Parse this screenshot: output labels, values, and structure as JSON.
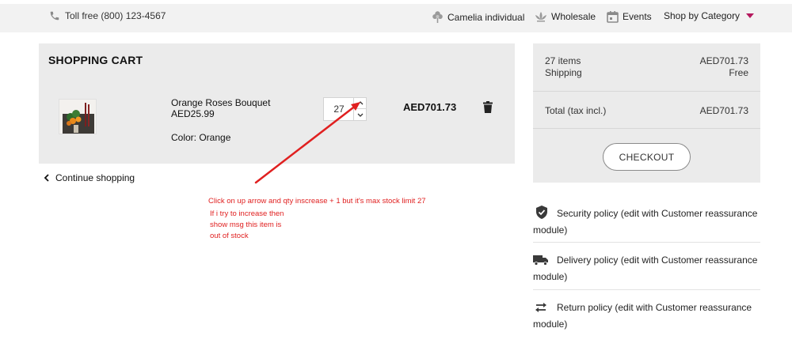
{
  "header": {
    "phone": "Toll free (800) 123-4567",
    "nav": [
      {
        "label": "Camelia individual",
        "icon": "flower-icon"
      },
      {
        "label": "Wholesale",
        "icon": "lotus-icon"
      },
      {
        "label": "Events",
        "icon": "calendar-icon"
      },
      {
        "label": "Shop by Category",
        "icon": "caret-down-icon"
      }
    ]
  },
  "cart": {
    "title": "SHOPPING CART",
    "item": {
      "name": "Orange Roses Bouquet",
      "unit_price": "AED25.99",
      "attribute": "Color: Orange",
      "quantity": "27",
      "line_total": "AED701.73"
    },
    "continue_label": "Continue shopping"
  },
  "annotation": {
    "line1": "Click on up arrow and qty inscrease + 1 but it's max  stock limit 27",
    "line2": "If i try to increase then",
    "line3": "show msg this item is",
    "line4": "out of stock",
    "color": "#e02020"
  },
  "summary": {
    "items_label": "27 items",
    "items_value": "AED701.73",
    "shipping_label": "Shipping",
    "shipping_value": "Free",
    "total_label": "Total (tax incl.)",
    "total_value": "AED701.73",
    "checkout_label": "CHECKOUT"
  },
  "reassurance": [
    {
      "text": "Security policy (edit with Customer reassurance module)",
      "icon": "shield-icon"
    },
    {
      "text": "Delivery policy (edit with Customer reassurance module)",
      "icon": "truck-icon"
    },
    {
      "text": "Return policy (edit with Customer reassurance module)",
      "icon": "swap-arrows-icon"
    }
  ],
  "colors": {
    "accent": "#b5195e",
    "panel": "#ebebeb",
    "topbar": "#f2f2f2"
  }
}
